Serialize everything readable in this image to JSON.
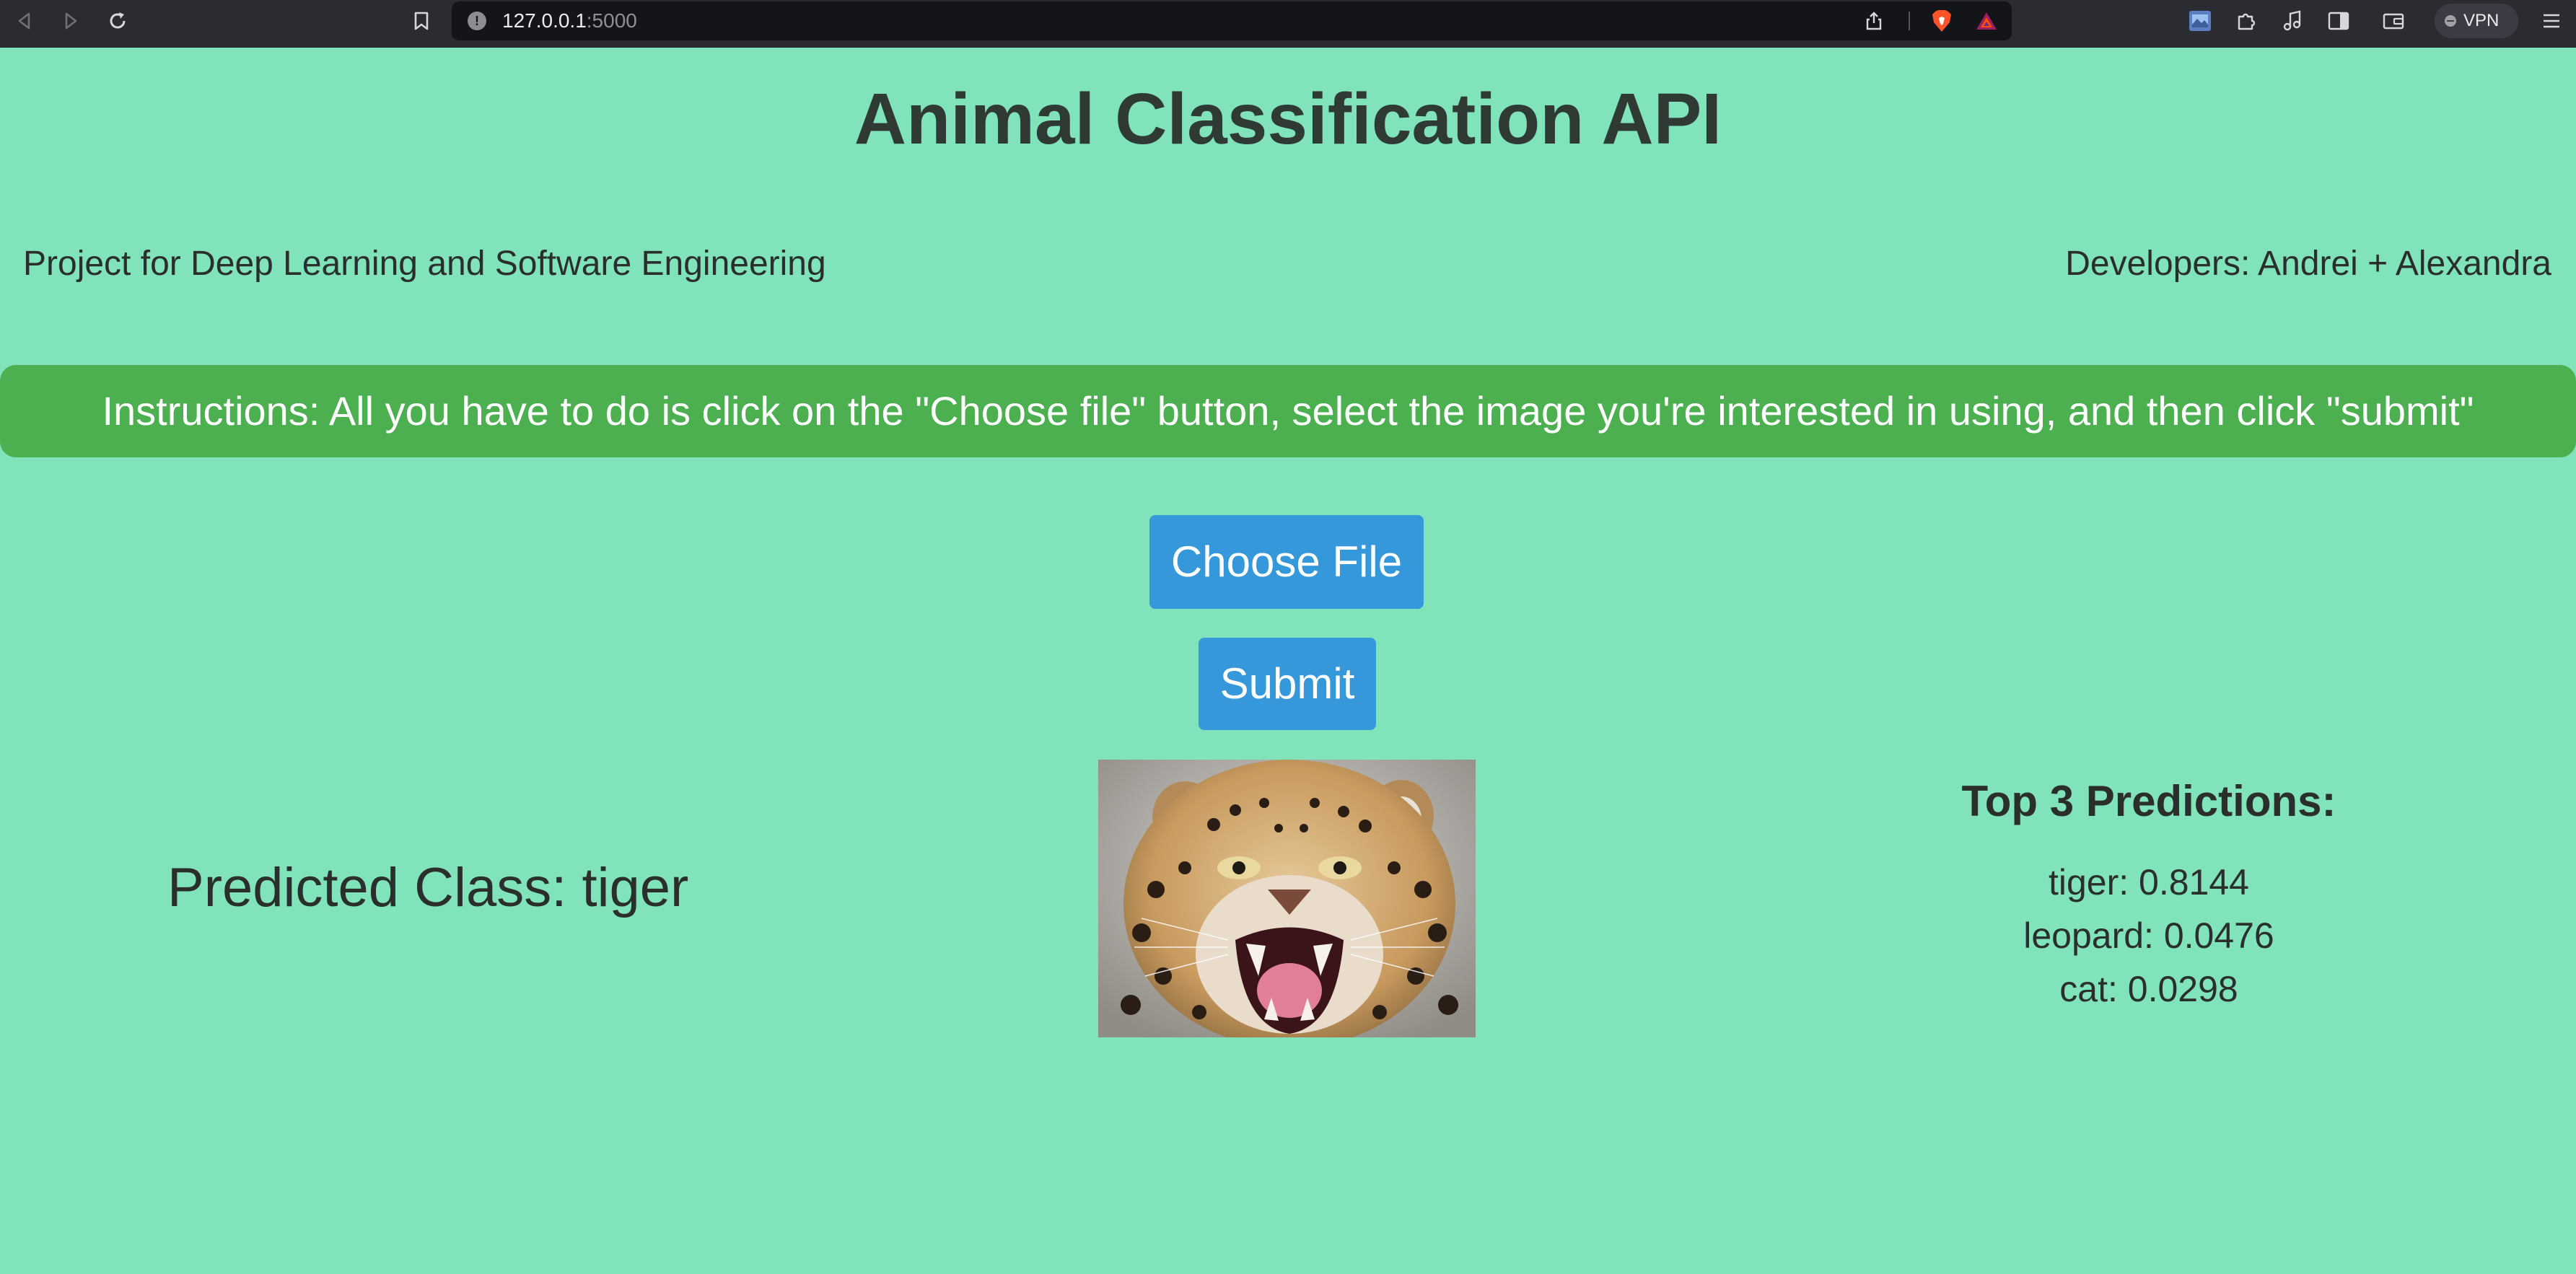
{
  "browser": {
    "url_host": "127.0.0.1",
    "url_port": ":5000",
    "vpn_label": "VPN",
    "icons": [
      "back-icon",
      "forward-icon",
      "reload-icon",
      "bookmark-icon",
      "site-info-icon",
      "share-icon",
      "brave-shields-icon",
      "brave-rewards-icon",
      "extension-icon",
      "puzzle-icon",
      "music-icon",
      "sidebar-icon",
      "wallet-icon",
      "menu-icon"
    ]
  },
  "page": {
    "title": "Animal Classification API",
    "project": "Project for Deep Learning and Software Engineering",
    "developers": "Developers: Andrei + Alexandra",
    "instructions": "Instructions: All you have to do is click on the \"Choose file\" button, select the image you're interested in using, and then click \"submit\"",
    "choose_file_label": "Choose File",
    "submit_label": "Submit",
    "predicted_class": "Predicted Class: tiger",
    "top_predictions_title": "Top 3 Predictions:",
    "top_predictions": [
      "tiger: 0.8144",
      "leopard: 0.0476",
      "cat: 0.0298"
    ]
  },
  "colors": {
    "background": "#80e3b9",
    "instructions_bg": "#4caf50",
    "button_bg": "#3498db",
    "browser_toolbar": "#2b2c32"
  }
}
